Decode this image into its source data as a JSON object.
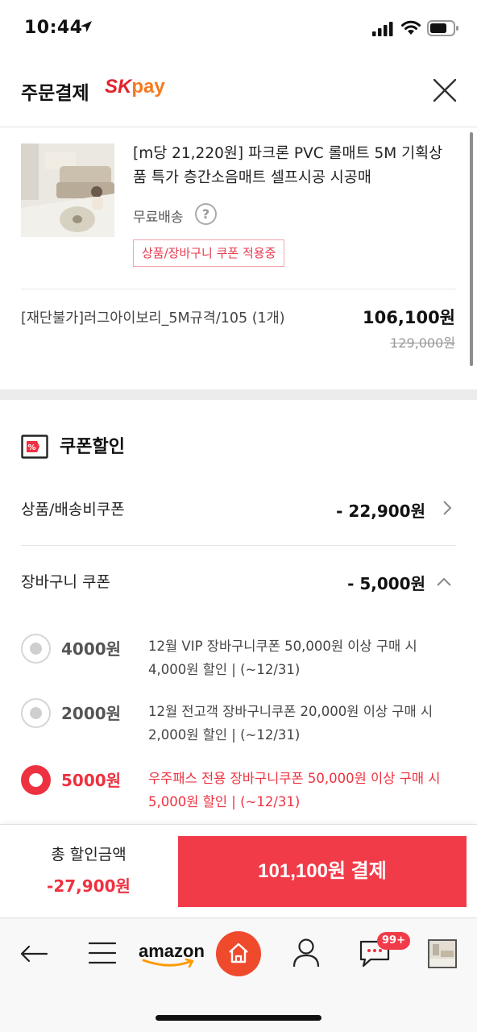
{
  "status_bar": {
    "time": "10:44"
  },
  "header": {
    "title": "주문결제",
    "brand_sk": "SK",
    "brand_pay": "pay"
  },
  "product": {
    "name": "[m당 21,220원] 파크론 PVC 롤매트 5M 기획상품 특가 층간소음매트 셀프시공 시공매",
    "shipping": "무료배송",
    "help": "?",
    "coupon_tag": "상품/장바구니 쿠폰 적용중",
    "option": "[재단불가]러그아이보리_5M규격/105 (1개)",
    "price": "106,100원",
    "original_price": "129,000원"
  },
  "coupon_section": {
    "title": "쿠폰할인",
    "product_coupon": {
      "label": "상품/배송비쿠폰",
      "amount": "- 22,900원"
    },
    "cart_coupon": {
      "label": "장바구니 쿠폰",
      "amount": "- 5,000원"
    },
    "options": [
      {
        "amount": "4000원",
        "desc": "12월 VIP 장바구니쿠폰 50,000원 이상 구매 시 4,000원 할인 | (~12/31)",
        "selected": false
      },
      {
        "amount": "2000원",
        "desc": "12월 전고객 장바구니쿠폰 20,000원 이상 구매 시 2,000원 할인 | (~12/31)",
        "selected": false
      },
      {
        "amount": "5000원",
        "desc": "우주패스 전용 장바구니쿠폰 50,000원 이상 구매 시 5,000원 할인 | (~12/31)",
        "selected": true
      }
    ]
  },
  "paybar": {
    "total_label": "총 할인금액",
    "total_value": "-27,900원",
    "pay_button": "101,100원 결제"
  },
  "nav": {
    "amazon": "amazon",
    "badge": "99+"
  },
  "colors": {
    "accent": "#f23b49",
    "sk_red": "#e2232b",
    "pay_orange": "#f47a20",
    "home_orange": "#f04a2d"
  }
}
